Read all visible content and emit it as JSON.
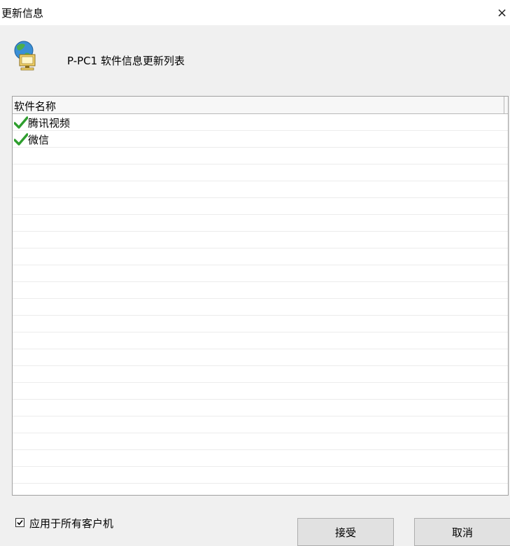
{
  "window": {
    "title": "更新信息",
    "close_glyph": "×"
  },
  "header": {
    "icon": "network-computer-icon",
    "text": "P-PC1 软件信息更新列表"
  },
  "list": {
    "column_header": "软件名称",
    "items": [
      {
        "label": "腾讯视频",
        "icon": "green-check-icon"
      },
      {
        "label": "微信",
        "icon": "green-check-icon"
      }
    ]
  },
  "apply_all": {
    "label": "应用于所有客户机",
    "checked": true
  },
  "buttons": {
    "accept": "接受",
    "cancel": "取消"
  },
  "colors": {
    "check_green": "#2e9e2e",
    "window_bg": "#f0f0f0",
    "list_bg": "#ffffff"
  }
}
